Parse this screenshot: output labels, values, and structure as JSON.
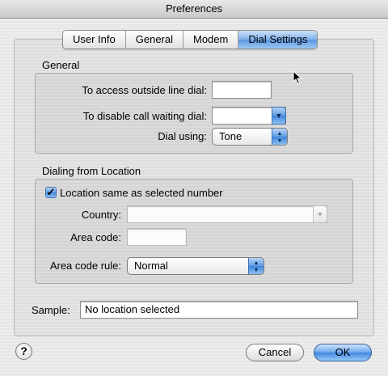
{
  "window": {
    "title": "Preferences"
  },
  "tabs": [
    {
      "label": "User Info",
      "active": false
    },
    {
      "label": "General",
      "active": false
    },
    {
      "label": "Modem",
      "active": false
    },
    {
      "label": "Dial Settings",
      "active": true
    }
  ],
  "general_group": {
    "title": "General",
    "outside_line_label": "To access outside line dial:",
    "outside_line_value": "",
    "call_waiting_label": "To disable call waiting dial:",
    "call_waiting_value": "",
    "dial_using_label": "Dial using:",
    "dial_using_value": "Tone"
  },
  "location_group": {
    "title": "Dialing from Location",
    "same_as_number_label": "Location same as selected number",
    "same_as_number_checked": true,
    "country_label": "Country:",
    "country_value": "",
    "area_code_label": "Area code:",
    "area_code_value": "",
    "area_code_rule_label": "Area code rule:",
    "area_code_rule_value": "Normal"
  },
  "sample": {
    "label": "Sample:",
    "value": "No location selected"
  },
  "buttons": {
    "help": "?",
    "cancel": "Cancel",
    "ok": "OK"
  },
  "icons": {
    "checkmark": "checkmark-icon",
    "combo_arrow": "chevron-down-icon",
    "popup_arrows": "up-down-arrows-icon",
    "pointer": "mouse-pointer-icon"
  }
}
